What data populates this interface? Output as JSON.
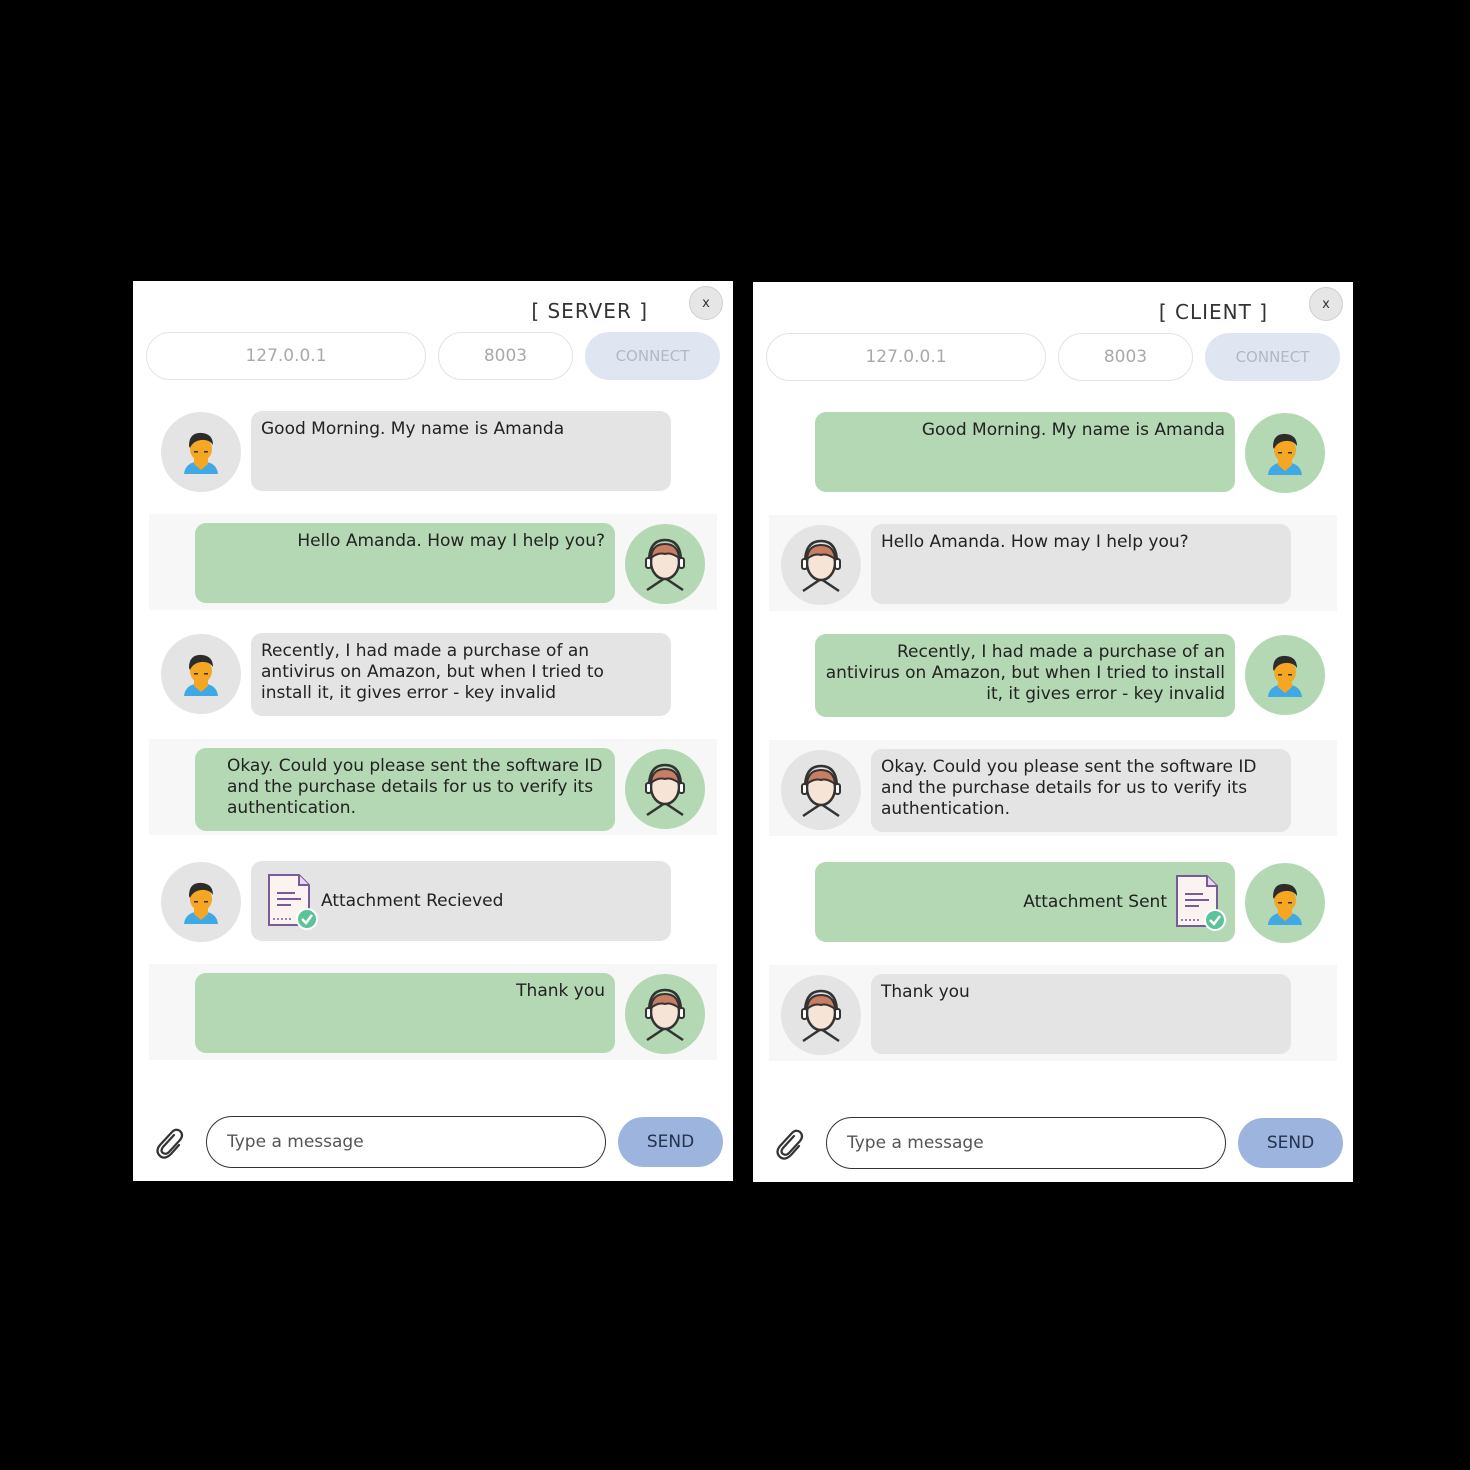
{
  "server": {
    "title": "[ SERVER ]",
    "close_label": "x",
    "ip": "127.0.0.1",
    "port": "8003",
    "connect_label": "CONNECT",
    "messages": [
      {
        "text": "Good Morning. My name is Amanda"
      },
      {
        "text": "Hello Amanda. How may I help you?"
      },
      {
        "text": "Recently, I had made a purchase of an antivirus on Amazon, but when I tried to install it, it gives error - key invalid"
      },
      {
        "text": "Okay. Could you please sent the software ID and the purchase details for us to verify its authentication."
      },
      {
        "text": "Attachment Recieved"
      },
      {
        "text": "Thank you"
      }
    ],
    "input_placeholder": "Type a message",
    "send_label": "SEND"
  },
  "client": {
    "title": "[ CLIENT ]",
    "close_label": "x",
    "ip": "127.0.0.1",
    "port": "8003",
    "connect_label": "CONNECT",
    "messages": [
      {
        "text": "Good Morning. My name is Amanda"
      },
      {
        "text": "Hello Amanda. How may I help you?"
      },
      {
        "text": "Recently, I had made a purchase of an antivirus on Amazon, but when I tried to install it, it gives error - key invalid"
      },
      {
        "text": "Okay. Could you please sent the software ID and the purchase details for us to verify its authentication."
      },
      {
        "text": "Attachment Sent"
      },
      {
        "text": "Thank you"
      }
    ],
    "input_placeholder": "Type a message",
    "send_label": "SEND"
  },
  "colors": {
    "bubble_grey": "#e4e4e4",
    "bubble_green": "#b4d8b3",
    "send_button": "#9db5de",
    "connect_button": "#dfe5f1",
    "row_shade": "#f7f7f7"
  },
  "icons": {
    "customer_avatar": "customer-avatar-icon",
    "agent_avatar": "agent-headset-avatar-icon",
    "attachment": "paperclip-icon",
    "document": "document-check-icon"
  }
}
